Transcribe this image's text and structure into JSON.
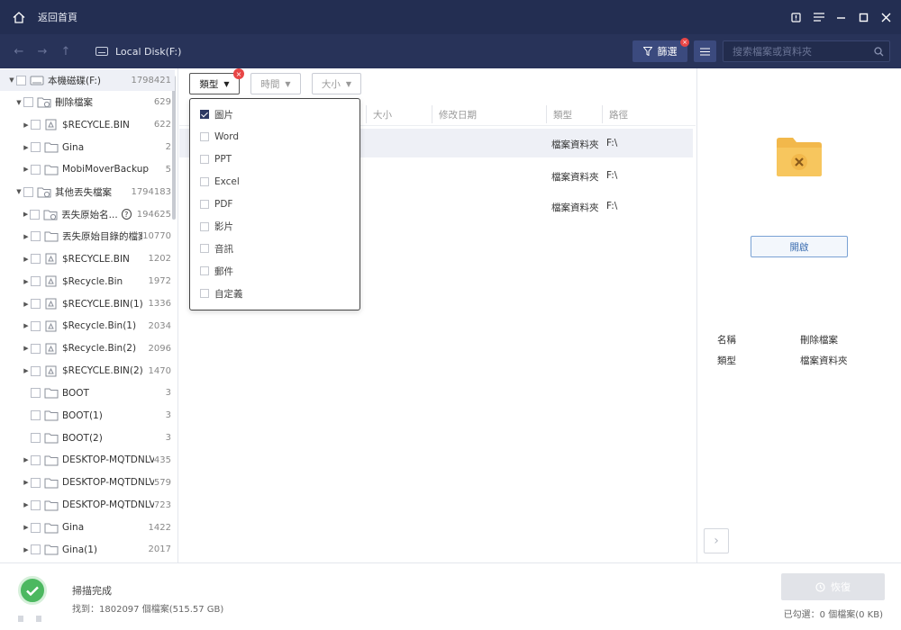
{
  "titlebar": {
    "title": "返回首頁"
  },
  "toolbar": {
    "location": "Local Disk(F:)",
    "filter_label": "篩選",
    "filter_badge": "×",
    "search_placeholder": "搜索檔案或資料夾"
  },
  "tree": [
    {
      "label": "本機磁碟(F:)",
      "count": "1798421",
      "level": 0,
      "arrow": "open",
      "icon": "drive"
    },
    {
      "label": "刪除檔案",
      "count": "629",
      "level": 1,
      "arrow": "open",
      "icon": "folder-deleted"
    },
    {
      "label": "$RECYCLE.BIN",
      "count": "622",
      "level": 2,
      "arrow": "closed",
      "icon": "recycle"
    },
    {
      "label": "Gina",
      "count": "2",
      "level": 2,
      "arrow": "closed",
      "icon": "folder"
    },
    {
      "label": "MobiMoverBackup",
      "count": "5",
      "level": 2,
      "arrow": "closed",
      "icon": "folder"
    },
    {
      "label": "其他丟失檔案",
      "count": "1794183",
      "level": 1,
      "arrow": "open",
      "icon": "folder-lost"
    },
    {
      "label": "丟失原始名...",
      "count": "194625",
      "level": 2,
      "arrow": "closed",
      "icon": "folder-lost",
      "help": "?"
    },
    {
      "label": "丟失原始目錄的檔案",
      "count": "10770",
      "level": 2,
      "arrow": "closed",
      "icon": "folder"
    },
    {
      "label": "$RECYCLE.BIN",
      "count": "1202",
      "level": 2,
      "arrow": "closed",
      "icon": "recycle"
    },
    {
      "label": "$Recycle.Bin",
      "count": "1972",
      "level": 2,
      "arrow": "closed",
      "icon": "recycle"
    },
    {
      "label": "$RECYCLE.BIN(1)",
      "count": "1336",
      "level": 2,
      "arrow": "closed",
      "icon": "recycle"
    },
    {
      "label": "$Recycle.Bin(1)",
      "count": "2034",
      "level": 2,
      "arrow": "closed",
      "icon": "recycle"
    },
    {
      "label": "$Recycle.Bin(2)",
      "count": "2096",
      "level": 2,
      "arrow": "closed",
      "icon": "recycle"
    },
    {
      "label": "$RECYCLE.BIN(2)",
      "count": "1470",
      "level": 2,
      "arrow": "closed",
      "icon": "recycle"
    },
    {
      "label": "BOOT",
      "count": "3",
      "level": 2,
      "arrow": "none",
      "icon": "folder"
    },
    {
      "label": "BOOT(1)",
      "count": "3",
      "level": 2,
      "arrow": "none",
      "icon": "folder"
    },
    {
      "label": "BOOT(2)",
      "count": "3",
      "level": 2,
      "arrow": "none",
      "icon": "folder"
    },
    {
      "label": "DESKTOP-MQTDNLV",
      "count": "435",
      "level": 2,
      "arrow": "closed",
      "icon": "folder"
    },
    {
      "label": "DESKTOP-MQTDNLV...",
      "count": "579",
      "level": 2,
      "arrow": "closed",
      "icon": "folder"
    },
    {
      "label": "DESKTOP-MQTDNLV...",
      "count": "723",
      "level": 2,
      "arrow": "closed",
      "icon": "folder"
    },
    {
      "label": "Gina",
      "count": "1422",
      "level": 2,
      "arrow": "closed",
      "icon": "folder"
    },
    {
      "label": "Gina(1)",
      "count": "2017",
      "level": 2,
      "arrow": "closed",
      "icon": "folder"
    }
  ],
  "filters": {
    "type_label": "類型",
    "time_label": "時間",
    "size_label": "大小",
    "badge": "×"
  },
  "columns": {
    "size": "大小",
    "modified": "修改日期",
    "type": "類型",
    "path": "路徑"
  },
  "rows": [
    {
      "type": "檔案資料夾",
      "path": "F:\\"
    },
    {
      "type": "檔案資料夾",
      "path": "F:\\"
    },
    {
      "type": "檔案資料夾",
      "path": "F:\\"
    }
  ],
  "type_options": [
    {
      "label": "圖片",
      "checked": true
    },
    {
      "label": "Word",
      "checked": false
    },
    {
      "label": "PPT",
      "checked": false
    },
    {
      "label": "Excel",
      "checked": false
    },
    {
      "label": "PDF",
      "checked": false
    },
    {
      "label": "影片",
      "checked": false
    },
    {
      "label": "音訊",
      "checked": false
    },
    {
      "label": "郵件",
      "checked": false
    },
    {
      "label": "自定義",
      "checked": false
    }
  ],
  "preview": {
    "open_label": "開啟",
    "name_key": "名稱",
    "name_value": "刪除檔案",
    "type_key": "類型",
    "type_value": "檔案資料夾",
    "next": "›"
  },
  "status": {
    "scan_done": "掃描完成",
    "found": "找到：1802097 個檔案(515.57 GB)",
    "recover_label": "恢復",
    "selected": "已勾選：0 個檔案(0 KB)"
  },
  "colors": {
    "titlebar": "#232e52",
    "toolbar": "#283359",
    "accent": "#3b4a7e",
    "success": "#4cb860",
    "badge": "#e84646",
    "folder": "#f2b84b"
  }
}
